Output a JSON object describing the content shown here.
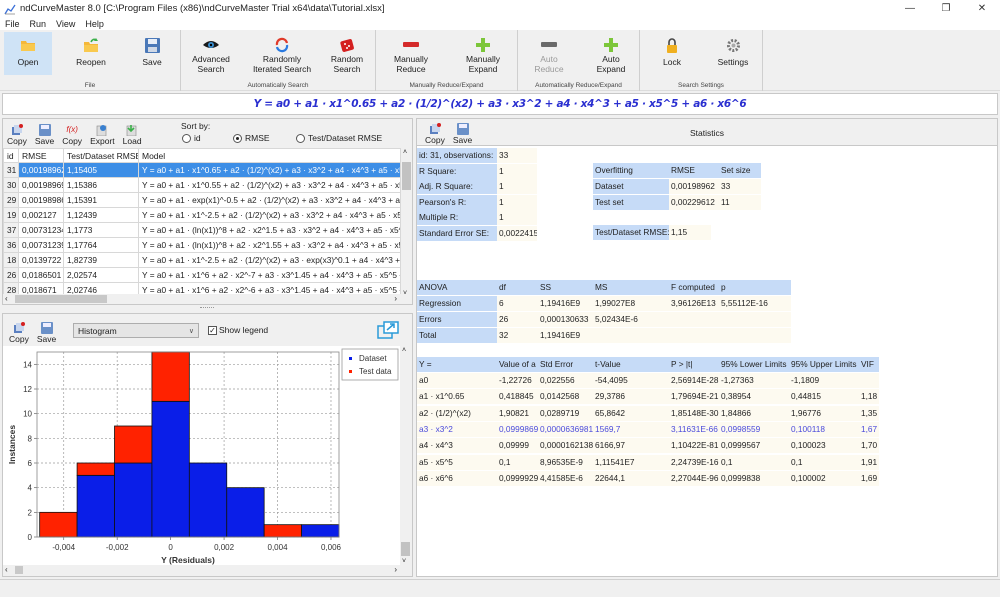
{
  "window": {
    "title": "ndCurveMaster 8.0 [C:\\Program Files (x86)\\ndCurveMaster Trial x64\\data\\Tutorial.xlsx]",
    "controls": [
      "—",
      "❐",
      "✕"
    ]
  },
  "menu": [
    "File",
    "Run",
    "View",
    "Help"
  ],
  "ribbon": {
    "groups": [
      {
        "label": "File",
        "buttons": [
          "Open",
          "Reopen",
          "Save"
        ]
      },
      {
        "label": "Automatically Search",
        "buttons": [
          "Advanced Search",
          "Randomly Iterated Search",
          "Random Search"
        ]
      },
      {
        "label": "Manually Reduce/Expand",
        "buttons": [
          "Manually Reduce",
          "Manually Expand"
        ]
      },
      {
        "label": "Automatically Reduce/Expand",
        "buttons": [
          "Auto Reduce",
          "Auto Expand"
        ]
      },
      {
        "label": "Search Settings",
        "buttons": [
          "Lock",
          "Settings"
        ]
      }
    ],
    "labels": {
      "open": "Open",
      "reopen": "Reopen",
      "save": "Save",
      "advanced1": "Advanced",
      "advanced2": "Search",
      "randomly1": "Randomly",
      "randomly2": "Iterated Search",
      "random1": "Random",
      "random2": "Search",
      "mreduce1": "Manually",
      "mreduce2": "Reduce",
      "mexpand1": "Manually",
      "mexpand2": "Expand",
      "areduce1": "Auto",
      "areduce2": "Reduce",
      "aexpand1": "Auto",
      "aexpand2": "Expand",
      "lock": "Lock",
      "settings": "Settings",
      "g_file": "File",
      "g_auto": "Automatically Search",
      "g_manual": "Manually Reduce/Expand",
      "g_autore": "Automatically Reduce/Expand",
      "g_search": "Search Settings"
    }
  },
  "formula": "Y = a0  + a1 · x1^0.65 + a2 · (1/2)^(x2) + a3 · x3^2 + a4 · x4^3 + a5 · x5^5 + a6 · x6^6",
  "models": {
    "toolbar": {
      "copy": "Copy",
      "save": "Save",
      "copyf": "Copy",
      "export": "Export",
      "load": "Load"
    },
    "sort": {
      "label": "Sort by:",
      "options": [
        "id",
        "RMSE",
        "Test/Dataset RMSE"
      ],
      "selected": "RMSE"
    },
    "columns": [
      "id",
      "RMSE",
      "Test/Dataset RMSE",
      "Model"
    ],
    "rows": [
      {
        "id": "31",
        "rmse": "0,00198962",
        "ratio": "1,15405",
        "model": "Y = a0  + a1 · x1^0.65 + a2 · (1/2)^(x2) + a3 · x3^2 + a4 · x4^3 + a5 · x5^5",
        "selected": true
      },
      {
        "id": "30",
        "rmse": "0,00198969",
        "ratio": "1,15386",
        "model": "Y = a0  + a1 · x1^0.55 + a2 · (1/2)^(x2) + a3 · x3^2 + a4 · x4^3 + a5 · x5^5"
      },
      {
        "id": "29",
        "rmse": "0,00198986",
        "ratio": "1,15391",
        "model": "Y = a0  + a1 · exp(x1)^-0.5 + a2 · (1/2)^(x2) + a3 · x3^2 + a4 · x4^3 + a5 ·"
      },
      {
        "id": "19",
        "rmse": "0,002127",
        "ratio": "1,12439",
        "model": "Y = a0  + a1 · x1^-2.5 + a2 · (1/2)^(x2) + a3 · x3^2 + a4 · x4^3 + a5 · x5^5"
      },
      {
        "id": "37",
        "rmse": "0,00731234",
        "ratio": "1,1773",
        "model": "Y = a0  + a1 · (ln(x1))^8 + a2 · x2^1.5 + a3 · x3^2 + a4 · x4^3 + a5 · x5^5 ·"
      },
      {
        "id": "36",
        "rmse": "0,00731239",
        "ratio": "1,17764",
        "model": "Y = a0  + a1 · (ln(x1))^8 + a2 · x2^1.55 + a3 · x3^2 + a4 · x4^3 + a5 · x5^5"
      },
      {
        "id": "18",
        "rmse": "0,0139722",
        "ratio": "1,82739",
        "model": "Y = a0  + a1 · x1^-2.5 + a2 · (1/2)^(x2) + a3 · exp(x3)^0.1 + a4 · x4^3 + a5"
      },
      {
        "id": "26",
        "rmse": "0,0186501",
        "ratio": "2,02574",
        "model": "Y = a0  + a1 · x1^6 + a2 · x2^-7 + a3 · x3^1.45 + a4 · x4^3 + a5 · x5^5 + a"
      },
      {
        "id": "28",
        "rmse": "0,018671",
        "ratio": "2,02746",
        "model": "Y = a0  + a1 · x1^6 + a2 · x2^-6 + a3 · x3^1.45 + a4 · x4^3 + a5 · x5^5 + a"
      }
    ]
  },
  "chart_panel": {
    "toolbar": {
      "copy": "Copy",
      "save": "Save"
    },
    "chart_type": "Histogram",
    "show_legend_label": "Show legend",
    "show_legend": true
  },
  "chart_data": {
    "type": "bar",
    "stacked": true,
    "title": "",
    "xlabel": "Y (Residuals)",
    "ylabel": "Instances",
    "bin_edges": [
      -0.0049,
      -0.0035,
      -0.0021,
      -0.0007,
      0.0007,
      0.0021,
      0.0035,
      0.0049,
      0.0063
    ],
    "series": [
      {
        "name": "Dataset",
        "color": "#0a1ee8",
        "values": [
          0,
          5,
          6,
          11,
          6,
          4,
          0,
          1
        ]
      },
      {
        "name": "Test data",
        "color": "#ff2200",
        "values": [
          2,
          1,
          3,
          4,
          0,
          0,
          1,
          0
        ]
      }
    ],
    "xlim": [
      -0.005,
      0.0063
    ],
    "ylim": [
      0,
      15
    ],
    "xticks": [
      -0.004,
      -0.002,
      0,
      0.002,
      0.004,
      0.006
    ],
    "xtick_labels": [
      "-0,004",
      "-0,002",
      "0",
      "0,002",
      "0,004",
      "0,006"
    ],
    "yticks": [
      0,
      2,
      4,
      6,
      8,
      10,
      12,
      14
    ],
    "ytick_labels": [
      "0",
      "2",
      "4",
      "6",
      "8",
      "10",
      "12",
      "14"
    ],
    "grid": true,
    "legend": "top-right"
  },
  "stats": {
    "toolbar": {
      "copy": "Copy",
      "save": "Save",
      "title": "Statistics"
    },
    "summary": [
      {
        "label": "id: 31, observations:",
        "value": "33"
      },
      {
        "label": "R Square:",
        "value": "1"
      },
      {
        "label": "Adj. R Square:",
        "value": "1"
      },
      {
        "label": "Pearson's R:",
        "value": "1"
      },
      {
        "label": "Multiple R:",
        "value": "1"
      },
      {
        "label": "Standard Error SE:",
        "value": "0,0022415"
      }
    ],
    "overfitting": {
      "header": [
        "Overfitting",
        "RMSE",
        "Set size"
      ],
      "rows": [
        [
          "Dataset",
          "0,00198962",
          "33"
        ],
        [
          "Test set",
          "0,00229612",
          "11"
        ]
      ],
      "ratio_label": "Test/Dataset RMSE:",
      "ratio_value": "1,15"
    },
    "anova": {
      "header": [
        "ANOVA",
        "df",
        "SS",
        "MS",
        "F computed",
        "p"
      ],
      "rows": [
        [
          "Regression",
          "6",
          "1,19416E9",
          "1,99027E8",
          "3,96126E13",
          "5,55112E-16"
        ],
        [
          "Errors",
          "26",
          "0,000130633",
          "5,02434E-6",
          "",
          ""
        ],
        [
          "Total",
          "32",
          "1,19416E9",
          "",
          "",
          ""
        ]
      ]
    },
    "coefficients": {
      "header": [
        "Y =",
        "Value of a",
        "Std Error",
        "t-Value",
        "P > |t|",
        "95% Lower Limits",
        "95% Upper Limits",
        "VIF"
      ],
      "rows": [
        [
          "a0",
          "-1,22726",
          "0,022556",
          "-54,4095",
          "2,56914E-28",
          "-1,27363",
          "-1,1809",
          ""
        ],
        [
          "a1 · x1^0.65",
          "0,418845",
          "0,0142568",
          "29,3786",
          "1,79694E-21",
          "0,38954",
          "0,44815",
          "1,18"
        ],
        [
          "a2 · (1/2)^(x2)",
          "1,90821",
          "0,0289719",
          "65,8642",
          "1,85148E-30",
          "1,84866",
          "1,96776",
          "1,35"
        ],
        [
          "a3 · x3^2",
          "0,0999869",
          "0,0000636981",
          "1569,7",
          "3,11631E-66",
          "0,0998559",
          "0,100118",
          "1,67"
        ],
        [
          "a4 · x4^3",
          "0,09999",
          "0,0000162138",
          "6166,97",
          "1,10422E-81",
          "0,0999567",
          "0,100023",
          "1,70"
        ],
        [
          "a5 · x5^5",
          "0,1",
          "8,96535E-9",
          "1,11541E7",
          "2,24739E-166",
          "0,1",
          "0,1",
          "1,91"
        ],
        [
          "a6 · x6^6",
          "0,0999929",
          "4,41585E-6",
          "22644,1",
          "2,27044E-96",
          "0,0999838",
          "0,100002",
          "1,69"
        ]
      ],
      "highlighted_row": 3
    }
  }
}
